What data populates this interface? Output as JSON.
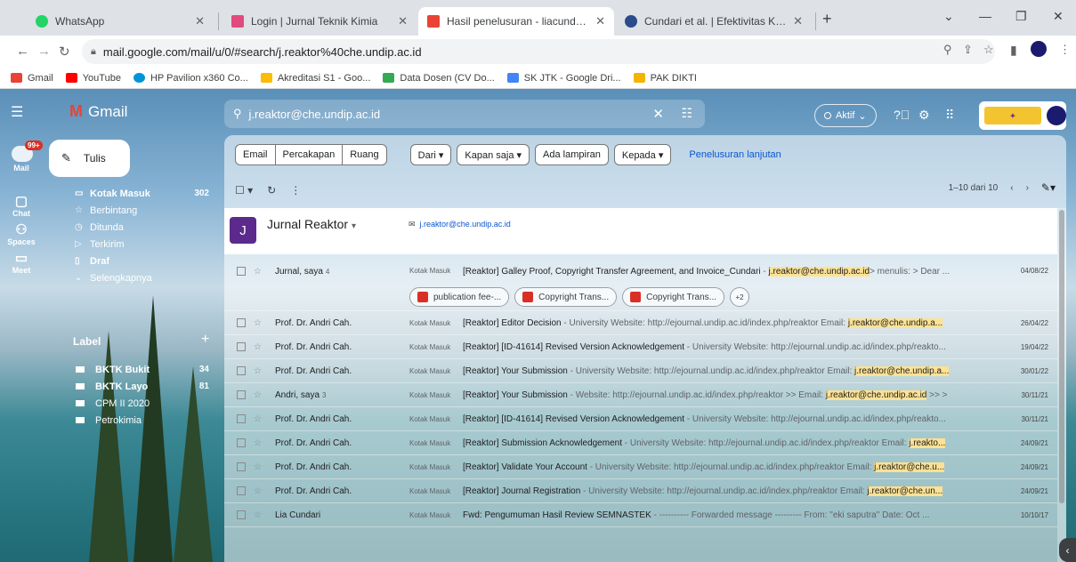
{
  "browser": {
    "tabs": [
      {
        "title": "WhatsApp",
        "fav": "#25d366"
      },
      {
        "title": "Login | Jurnal Teknik Kimia",
        "fav": "#e04a7d"
      },
      {
        "title": "Hasil penelusuran - liacundari@",
        "fav": "#ea4335"
      },
      {
        "title": "Cundari et al. | Efektivitas Karbon",
        "fav": "#2a4c8c"
      }
    ],
    "url": "mail.google.com/mail/u/0/#search/j.reaktor%40che.undip.ac.id",
    "bookmarks": [
      {
        "label": "Gmail",
        "color": "#ea4335"
      },
      {
        "label": "YouTube",
        "color": "#ff0000"
      },
      {
        "label": "HP Pavilion x360 Co...",
        "color": "#0096d6"
      },
      {
        "label": "Akreditasi S1 - Goo...",
        "color": "#fbbc04"
      },
      {
        "label": "Data Dosen (CV Do...",
        "color": "#34a853"
      },
      {
        "label": "SK JTK - Google Dri...",
        "color": "#4285f4"
      },
      {
        "label": "PAK DIKTI",
        "color": "#f4b400"
      }
    ]
  },
  "gmail": {
    "app_name": "Gmail",
    "search_query": "j.reaktor@che.undip.ac.id",
    "status": "Aktif",
    "left_icons": {
      "mail": "Mail",
      "mail_badge": "99+",
      "chat": "Chat",
      "spaces": "Spaces",
      "meet": "Meet"
    },
    "compose": "Tulis",
    "nav": [
      {
        "label": "Kotak Masuk",
        "count": "302",
        "bold": true,
        "icon": "inbox"
      },
      {
        "label": "Berbintang",
        "count": "",
        "bold": false,
        "icon": "star"
      },
      {
        "label": "Ditunda",
        "count": "",
        "bold": false,
        "icon": "clock"
      },
      {
        "label": "Terkirim",
        "count": "",
        "bold": false,
        "icon": "send"
      },
      {
        "label": "Draf",
        "count": "",
        "bold": true,
        "icon": "draft"
      },
      {
        "label": "Selengkapnya",
        "count": "",
        "bold": false,
        "icon": "chevron"
      }
    ],
    "labels_title": "Label",
    "labels": [
      {
        "label": "BKTK Bukit",
        "count": "34",
        "bold": true
      },
      {
        "label": "BKTK Layo",
        "count": "81",
        "bold": true
      },
      {
        "label": "CPM II 2020",
        "count": "",
        "bold": false
      },
      {
        "label": "Petrokimia",
        "count": "",
        "bold": false
      }
    ],
    "filters": {
      "segments": [
        "Email",
        "Percakapan",
        "Ruang"
      ],
      "chips": [
        "Dari ▾",
        "Kapan saja ▾",
        "Ada lampiran",
        "Kepada ▾"
      ],
      "advanced": "Penelusuran lanjutan"
    },
    "pager": "1–10 dari 10",
    "contact": {
      "initial": "J",
      "name": "Jurnal Reaktor",
      "email": "j.reaktor@che.undip.ac.id"
    },
    "emails": [
      {
        "sender": "Jurnal, saya",
        "count": "4",
        "label": "Kotak Masuk",
        "subject": "[Reaktor] Galley Proof, Copyright Transfer Agreement, and Invoice_Cundari",
        "snip_before": " - ",
        "hl": "j.reaktor@che.undip.ac.id",
        "snip_after": "> menulis: > Dear ...",
        "date": "04/08/22"
      },
      {
        "sender": "Prof. Dr. Andri Cah.",
        "count": "",
        "label": "Kotak Masuk",
        "subject": "[Reaktor] Editor Decision",
        "snip_before": " - University Website: http://ejournal.undip.ac.id/index.php/reaktor Email: ",
        "hl": "j.reaktor@che.undip.a...",
        "snip_after": "",
        "date": "26/04/22"
      },
      {
        "sender": "Prof. Dr. Andri Cah.",
        "count": "",
        "label": "Kotak Masuk",
        "subject": "[Reaktor] [ID-41614] Revised Version Acknowledgement",
        "snip_before": " - University Website: http://ejournal.undip.ac.id/index.php/reakto...",
        "hl": "",
        "snip_after": "",
        "date": "19/04/22"
      },
      {
        "sender": "Prof. Dr. Andri Cah.",
        "count": "",
        "label": "Kotak Masuk",
        "subject": "[Reaktor] Your Submission",
        "snip_before": " - University Website: http://ejournal.undip.ac.id/index.php/reaktor Email: ",
        "hl": "j.reaktor@che.undip.a...",
        "snip_after": "",
        "date": "30/01/22"
      },
      {
        "sender": "Andri, saya",
        "count": "3",
        "label": "Kotak Masuk",
        "subject": "[Reaktor] Your Submission",
        "snip_before": " - Website: http://ejournal.undip.ac.id/index.php/reaktor >> Email: ",
        "hl": "j.reaktor@che.undip.ac.id",
        "snip_after": " >> >",
        "date": "30/11/21"
      },
      {
        "sender": "Prof. Dr. Andri Cah.",
        "count": "",
        "label": "Kotak Masuk",
        "subject": "[Reaktor] [ID-41614] Revised Version Acknowledgement",
        "snip_before": " - University Website: http://ejournal.undip.ac.id/index.php/reakto...",
        "hl": "",
        "snip_after": "",
        "date": "30/11/21"
      },
      {
        "sender": "Prof. Dr. Andri Cah.",
        "count": "",
        "label": "Kotak Masuk",
        "subject": "[Reaktor] Submission Acknowledgement",
        "snip_before": " - University Website: http://ejournal.undip.ac.id/index.php/reaktor Email: ",
        "hl": "j.reakto...",
        "snip_after": "",
        "date": "24/09/21"
      },
      {
        "sender": "Prof. Dr. Andri Cah.",
        "count": "",
        "label": "Kotak Masuk",
        "subject": "[Reaktor] Validate Your Account",
        "snip_before": " - University Website: http://ejournal.undip.ac.id/index.php/reaktor Email: ",
        "hl": "j.reaktor@che.u...",
        "snip_after": "",
        "date": "24/09/21"
      },
      {
        "sender": "Prof. Dr. Andri Cah.",
        "count": "",
        "label": "Kotak Masuk",
        "subject": "[Reaktor] Journal Registration",
        "snip_before": " - University Website: http://ejournal.undip.ac.id/index.php/reaktor Email: ",
        "hl": "j.reaktor@che.un...",
        "snip_after": "",
        "date": "24/09/21"
      },
      {
        "sender": "Lia Cundari",
        "count": "",
        "label": "Kotak Masuk",
        "subject": "Fwd: Pengumuman Hasil Review SEMNASTEK",
        "snip_before": " - ---------- Forwarded message --------- From: \"eki saputra\" Date: Oct ...",
        "hl": "",
        "snip_after": "",
        "date": "10/10/17"
      }
    ],
    "attachments": [
      "publication fee-...",
      "Copyright Trans...",
      "Copyright Trans..."
    ],
    "more_attachments": "+2"
  }
}
